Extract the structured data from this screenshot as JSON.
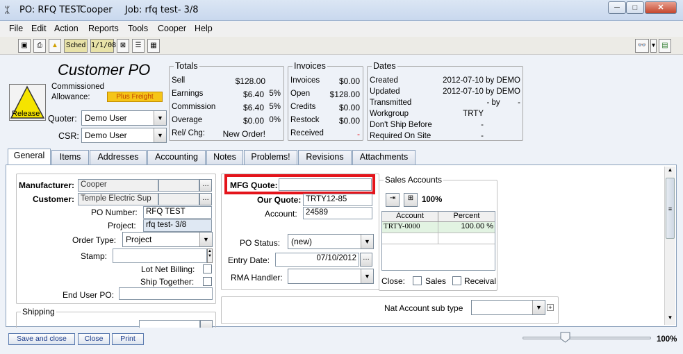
{
  "window": {
    "title_po": "PO: RFQ TEST",
    "title_user": "Cooper",
    "title_job": "Job: rfq test-  3/8",
    "minimize": "─",
    "maximize": "□",
    "close": "✕"
  },
  "menu": [
    "File",
    "Edit",
    "Action",
    "Reports",
    "Tools",
    "Cooper",
    "Help"
  ],
  "toolbar": {
    "sched": "Sched",
    "date": "1/1/08"
  },
  "header": {
    "title": "Customer PO",
    "release_label": "Release",
    "commissioned": "Commissioned",
    "allowance_label": "Allowance:",
    "allowance_value": "Plus Freight",
    "quoter_label": "Quoter:",
    "quoter_value": "Demo User",
    "csr_label": "CSR:",
    "csr_value": "Demo User"
  },
  "totals": {
    "legend": "Totals",
    "rows": [
      {
        "label": "Sell",
        "amount": "$128.00",
        "pct": ""
      },
      {
        "label": "Earnings",
        "amount": "$6.40",
        "pct": "5%"
      },
      {
        "label": "Commission",
        "amount": "$6.40",
        "pct": "5%"
      },
      {
        "label": "Overage",
        "amount": "$0.00",
        "pct": "0%"
      },
      {
        "label": "Rel/ Chg:",
        "amount": "New Order!",
        "pct": ""
      }
    ]
  },
  "invoices": {
    "legend": "Invoices",
    "rows": [
      {
        "label": "Invoices",
        "amount": "$0.00"
      },
      {
        "label": "Open",
        "amount": "$128.00"
      },
      {
        "label": "Credits",
        "amount": "$0.00"
      },
      {
        "label": "Restock",
        "amount": "$0.00"
      },
      {
        "label": "Received",
        "amount": "-"
      }
    ]
  },
  "dates": {
    "legend": "Dates",
    "rows": [
      {
        "label": "Created",
        "value": "2012-07-10 by DEMO"
      },
      {
        "label": "Updated",
        "value": "2012-07-10 by DEMO"
      },
      {
        "label": "Transmitted",
        "value": "- by        -"
      },
      {
        "label": "Workgroup",
        "value": "TRTY"
      },
      {
        "label": "Don't Ship Before",
        "value": "-"
      },
      {
        "label": "Required On Site",
        "value": "-"
      }
    ]
  },
  "tabs": [
    "General",
    "Items",
    "Addresses",
    "Accounting",
    "Notes",
    "Problems!",
    "Revisions",
    "Attachments"
  ],
  "general": {
    "manufacturer_label": "Manufacturer:",
    "manufacturer_value": "Cooper",
    "customer_label": "Customer:",
    "customer_value": "Temple Electric Sup",
    "po_number_label": "PO Number:",
    "po_number_value": "RFQ TEST",
    "project_label": "Project:",
    "project_value": "rfq test-  3/8",
    "order_type_label": "Order Type:",
    "order_type_value": "Project",
    "stamp_label": "Stamp:",
    "lot_net_label": "Lot Net Billing:",
    "ship_together_label": "Ship Together:",
    "end_user_label": "End User PO:",
    "shipping_legend": "Shipping",
    "mfg_quote_label": "MFG Quote:",
    "our_quote_label": "Our Quote:",
    "our_quote_value": "TRTY12-85",
    "account_label": "Account:",
    "account_value": "24589",
    "po_status_label": "PO Status:",
    "po_status_value": "(new)",
    "entry_date_label": "Entry Date:",
    "entry_date_value": "07/10/2012",
    "rma_label": "RMA Handler:",
    "nat_account_label": "Nat Account sub type",
    "sales_accounts_legend": "Sales Accounts",
    "sales_pct": "100%",
    "sa_col_account": "Account",
    "sa_col_percent": "Percent",
    "sa_row_account": "TRTY-0000",
    "sa_row_percent": "100.00 %",
    "close_label": "Close:",
    "close_sales": "Sales",
    "close_receival": "Receival"
  },
  "bottom": {
    "save_close": "Save and close",
    "close": "Close",
    "print": "Print",
    "zoom": "100%"
  },
  "colors": {
    "highlight": "#e4141b",
    "allowance_bg": "#f5c518",
    "release_bg": "#f5e400"
  }
}
